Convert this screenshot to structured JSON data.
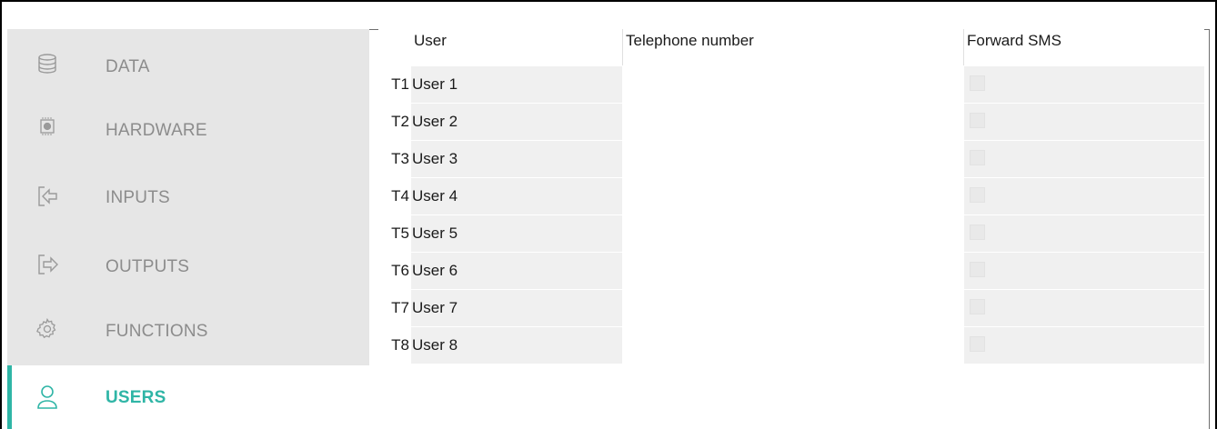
{
  "sidebar": {
    "items": [
      {
        "label": "DATA",
        "icon": "database-icon",
        "active": false
      },
      {
        "label": "HARDWARE",
        "icon": "chip-icon",
        "active": false
      },
      {
        "label": "INPUTS",
        "icon": "input-arrow-icon",
        "active": false
      },
      {
        "label": "OUTPUTS",
        "icon": "output-arrow-icon",
        "active": false
      },
      {
        "label": "FUNCTIONS",
        "icon": "gear-icon",
        "active": false
      },
      {
        "label": "USERS",
        "icon": "user-icon",
        "active": true
      }
    ],
    "accent_color": "#2fb5a6"
  },
  "table": {
    "columns": [
      "User",
      "Telephone number",
      "Forward SMS"
    ],
    "rows": [
      {
        "id": "T1",
        "user": "User 1",
        "telephone": "",
        "forward_sms": false
      },
      {
        "id": "T2",
        "user": "User 2",
        "telephone": "",
        "forward_sms": false
      },
      {
        "id": "T3",
        "user": "User 3",
        "telephone": "",
        "forward_sms": false
      },
      {
        "id": "T4",
        "user": "User 4",
        "telephone": "",
        "forward_sms": false
      },
      {
        "id": "T5",
        "user": "User 5",
        "telephone": "",
        "forward_sms": false
      },
      {
        "id": "T6",
        "user": "User 6",
        "telephone": "",
        "forward_sms": false
      },
      {
        "id": "T7",
        "user": "User 7",
        "telephone": "",
        "forward_sms": false
      },
      {
        "id": "T8",
        "user": "User 8",
        "telephone": "",
        "forward_sms": false
      }
    ]
  }
}
